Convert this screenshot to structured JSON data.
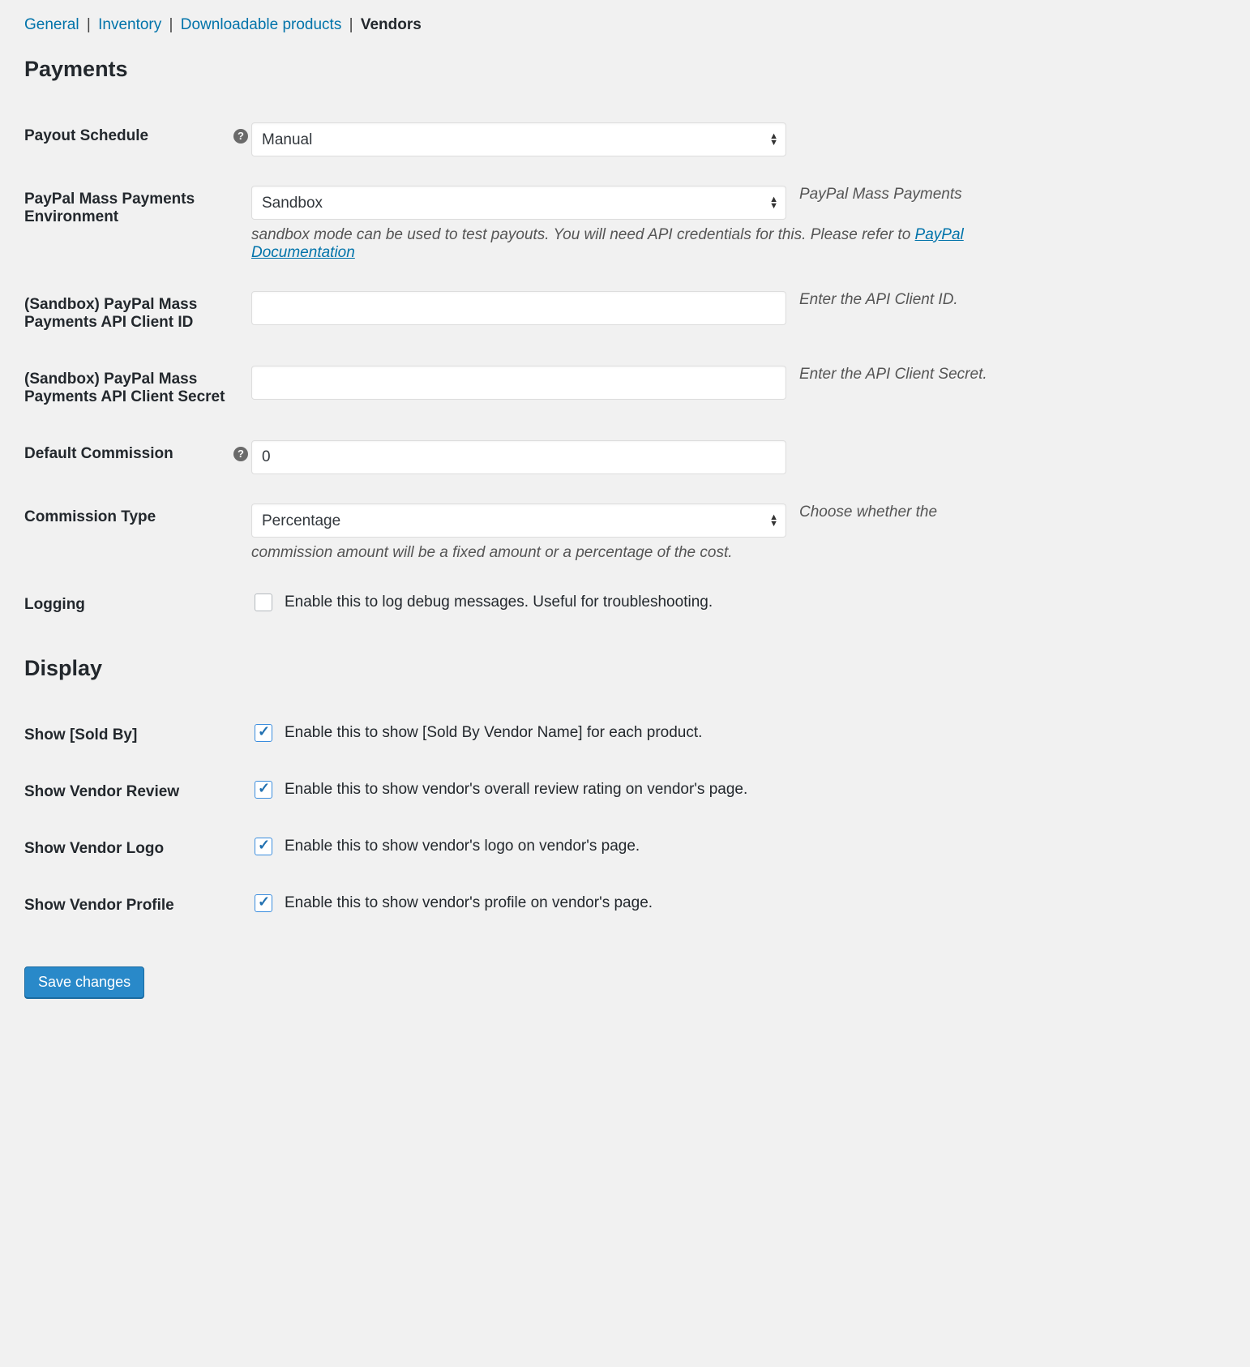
{
  "subnav": {
    "items": [
      {
        "label": "General"
      },
      {
        "label": "Inventory"
      },
      {
        "label": "Downloadable products"
      },
      {
        "label": "Vendors"
      }
    ],
    "current_index": 3
  },
  "sections": {
    "payments_title": "Payments",
    "display_title": "Display"
  },
  "fields": {
    "payout_schedule": {
      "label": "Payout Schedule",
      "value": "Manual"
    },
    "pp_env": {
      "label": "PayPal Mass Payments Environment",
      "value": "Sandbox",
      "side": "PayPal Mass Payments",
      "desc_pre": "sandbox mode can be used to test payouts. You will need API credentials for this. Please refer to ",
      "link_text": "PayPal Documentation"
    },
    "pp_client_id": {
      "label": "(Sandbox) PayPal Mass Payments API Client ID",
      "value": "",
      "side": "Enter the API Client ID."
    },
    "pp_client_secret": {
      "label": "(Sandbox) PayPal Mass Payments API Client Secret",
      "value": "",
      "side": "Enter the API Client Secret."
    },
    "default_commission": {
      "label": "Default Commission",
      "value": "0"
    },
    "commission_type": {
      "label": "Commission Type",
      "value": "Percentage",
      "side": "Choose whether the",
      "desc_block": "commission amount will be a fixed amount or a percentage of the cost."
    },
    "logging": {
      "label": "Logging",
      "check_label": "Enable this to log debug messages. Useful for troubleshooting.",
      "checked": false
    },
    "show_sold_by": {
      "label": "Show [Sold By]",
      "check_label": "Enable this to show [Sold By Vendor Name] for each product.",
      "checked": true
    },
    "show_vendor_review": {
      "label": "Show Vendor Review",
      "check_label": "Enable this to show vendor's overall review rating on vendor's page.",
      "checked": true
    },
    "show_vendor_logo": {
      "label": "Show Vendor Logo",
      "check_label": "Enable this to show vendor's logo on vendor's page.",
      "checked": true
    },
    "show_vendor_profile": {
      "label": "Show Vendor Profile",
      "check_label": "Enable this to show vendor's profile on vendor's page.",
      "checked": true
    }
  },
  "submit_label": "Save changes"
}
